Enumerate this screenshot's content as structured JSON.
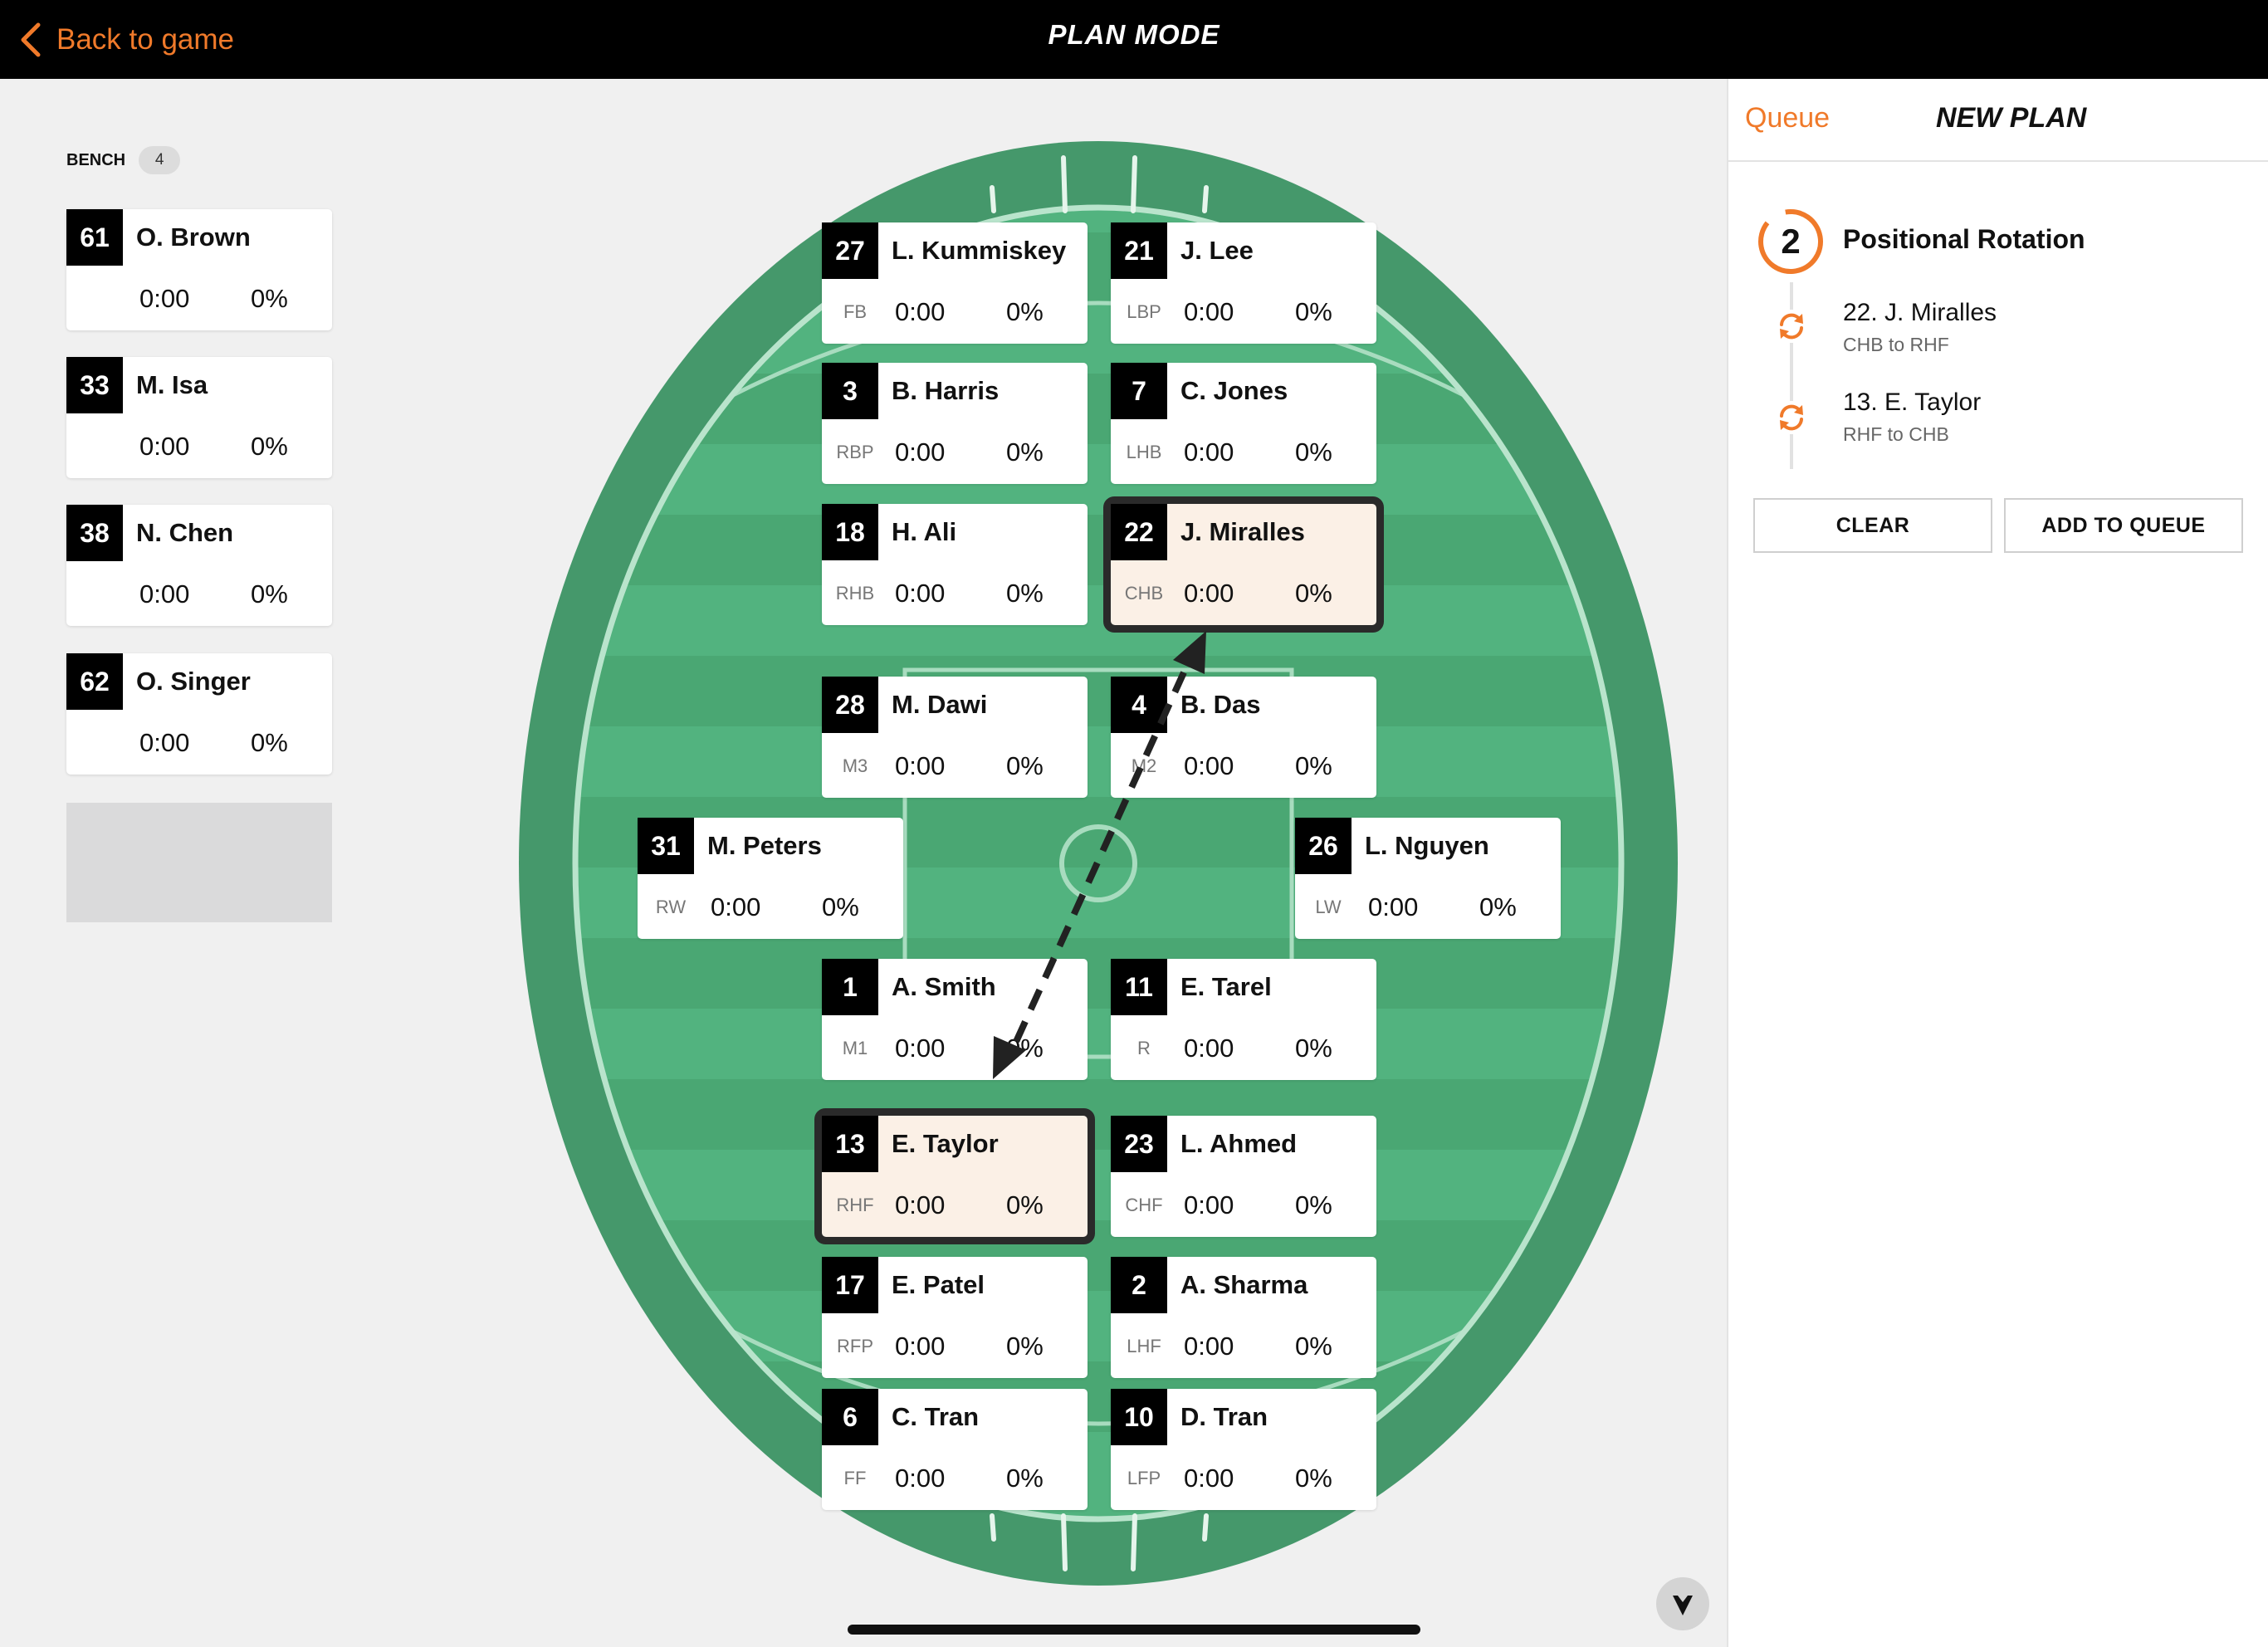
{
  "header": {
    "back_label": "Back to game",
    "title": "PLAN MODE"
  },
  "bench": {
    "label": "BENCH",
    "count": "4",
    "players": [
      {
        "number": "61",
        "name": "O. Brown",
        "time": "0:00",
        "pct": "0%"
      },
      {
        "number": "33",
        "name": "M. Isa",
        "time": "0:00",
        "pct": "0%"
      },
      {
        "number": "38",
        "name": "N. Chen",
        "time": "0:00",
        "pct": "0%"
      },
      {
        "number": "62",
        "name": "O. Singer",
        "time": "0:00",
        "pct": "0%"
      }
    ]
  },
  "field": {
    "players": [
      {
        "number": "27",
        "name": "L. Kummiskey",
        "pos": "FB",
        "time": "0:00",
        "pct": "0%"
      },
      {
        "number": "21",
        "name": "J. Lee",
        "pos": "LBP",
        "time": "0:00",
        "pct": "0%"
      },
      {
        "number": "3",
        "name": "B. Harris",
        "pos": "RBP",
        "time": "0:00",
        "pct": "0%"
      },
      {
        "number": "7",
        "name": "C. Jones",
        "pos": "LHB",
        "time": "0:00",
        "pct": "0%"
      },
      {
        "number": "18",
        "name": "H. Ali",
        "pos": "RHB",
        "time": "0:00",
        "pct": "0%"
      },
      {
        "number": "22",
        "name": "J. Miralles",
        "pos": "CHB",
        "time": "0:00",
        "pct": "0%",
        "selected": true
      },
      {
        "number": "28",
        "name": "M. Dawi",
        "pos": "M3",
        "time": "0:00",
        "pct": "0%"
      },
      {
        "number": "4",
        "name": "B. Das",
        "pos": "M2",
        "time": "0:00",
        "pct": "0%"
      },
      {
        "number": "31",
        "name": "M. Peters",
        "pos": "RW",
        "time": "0:00",
        "pct": "0%"
      },
      {
        "number": "26",
        "name": "L. Nguyen",
        "pos": "LW",
        "time": "0:00",
        "pct": "0%"
      },
      {
        "number": "1",
        "name": "A. Smith",
        "pos": "M1",
        "time": "0:00",
        "pct": "0%"
      },
      {
        "number": "11",
        "name": "E. Tarel",
        "pos": "R",
        "time": "0:00",
        "pct": "0%"
      },
      {
        "number": "13",
        "name": "E. Taylor",
        "pos": "RHF",
        "time": "0:00",
        "pct": "0%",
        "selected": true
      },
      {
        "number": "23",
        "name": "L. Ahmed",
        "pos": "CHF",
        "time": "0:00",
        "pct": "0%"
      },
      {
        "number": "17",
        "name": "E. Patel",
        "pos": "RFP",
        "time": "0:00",
        "pct": "0%"
      },
      {
        "number": "2",
        "name": "A. Sharma",
        "pos": "LHF",
        "time": "0:00",
        "pct": "0%"
      },
      {
        "number": "6",
        "name": "C. Tran",
        "pos": "FF",
        "time": "0:00",
        "pct": "0%"
      },
      {
        "number": "10",
        "name": "D. Tran",
        "pos": "LFP",
        "time": "0:00",
        "pct": "0%"
      }
    ]
  },
  "panel": {
    "tab_queue": "Queue",
    "tab_new_plan": "NEW PLAN",
    "plan_number": "2",
    "plan_title": "Positional Rotation",
    "rotations": [
      {
        "name": "22. J. Miralles",
        "sub": "CHB to RHF"
      },
      {
        "name": "13. E. Taylor",
        "sub": "RHF to CHB"
      }
    ],
    "clear_label": "CLEAR",
    "add_label": "ADD TO QUEUE"
  },
  "colors": {
    "accent": "#f07a2a",
    "field_outer": "#45986b",
    "field_inner": "#52b37f",
    "annotation_arrow": "#e8432a"
  },
  "icons": {
    "back": "chevron-left-icon",
    "rotation": "rotate-icon",
    "scroll": "chevron-down-icon"
  }
}
